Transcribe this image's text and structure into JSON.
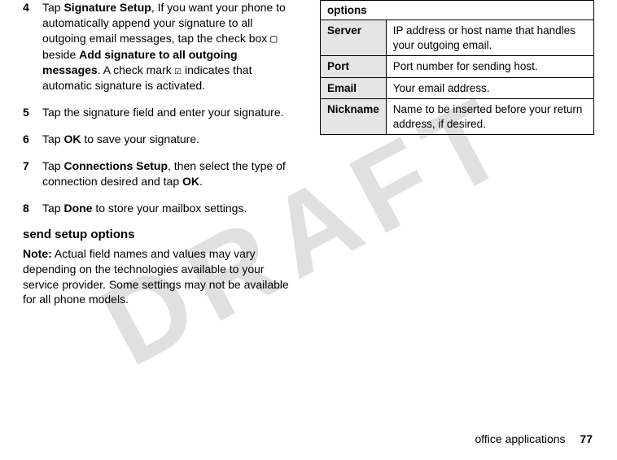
{
  "watermark": "DRAFT",
  "steps": [
    {
      "num": "4",
      "pre": "Tap ",
      "b1": "Signature Setup",
      "mid1": ", If you want your phone to automatically append your signature to all outgoing email messages, tap the check box ",
      "cb_empty": "▢",
      "mid2": " beside ",
      "b2": "Add signature to all outgoing messages",
      "mid3": ". A check mark ",
      "cb_checked": "☑",
      "post": " indicates that automatic signature is activated."
    },
    {
      "num": "5",
      "text": "Tap the signature field and enter your signature."
    },
    {
      "num": "6",
      "pre": "Tap ",
      "b1": "OK",
      "post": " to save your signature."
    },
    {
      "num": "7",
      "pre": "Tap ",
      "b1": "Connections Setup",
      "mid1": ", then select the type of connection desired and tap ",
      "b2": "OK",
      "post": "."
    },
    {
      "num": "8",
      "pre": "Tap ",
      "b1": "Done",
      "post": " to store your mailbox settings."
    }
  ],
  "section_heading": "send setup options",
  "note_label": "Note:",
  "note_text": " Actual field names and values may vary depending on the technologies available to your service provider. Some settings may not be available for all phone models.",
  "table_header": "options",
  "options": [
    {
      "label": "Server",
      "desc": "IP address or host name that handles your outgoing email."
    },
    {
      "label": "Port",
      "desc": "Port number for sending host."
    },
    {
      "label": "Email",
      "desc": "Your email address."
    },
    {
      "label": "Nickname",
      "desc": "Name to be inserted before your return address, if desired."
    }
  ],
  "footer_text": "office applications",
  "page_num": "77"
}
